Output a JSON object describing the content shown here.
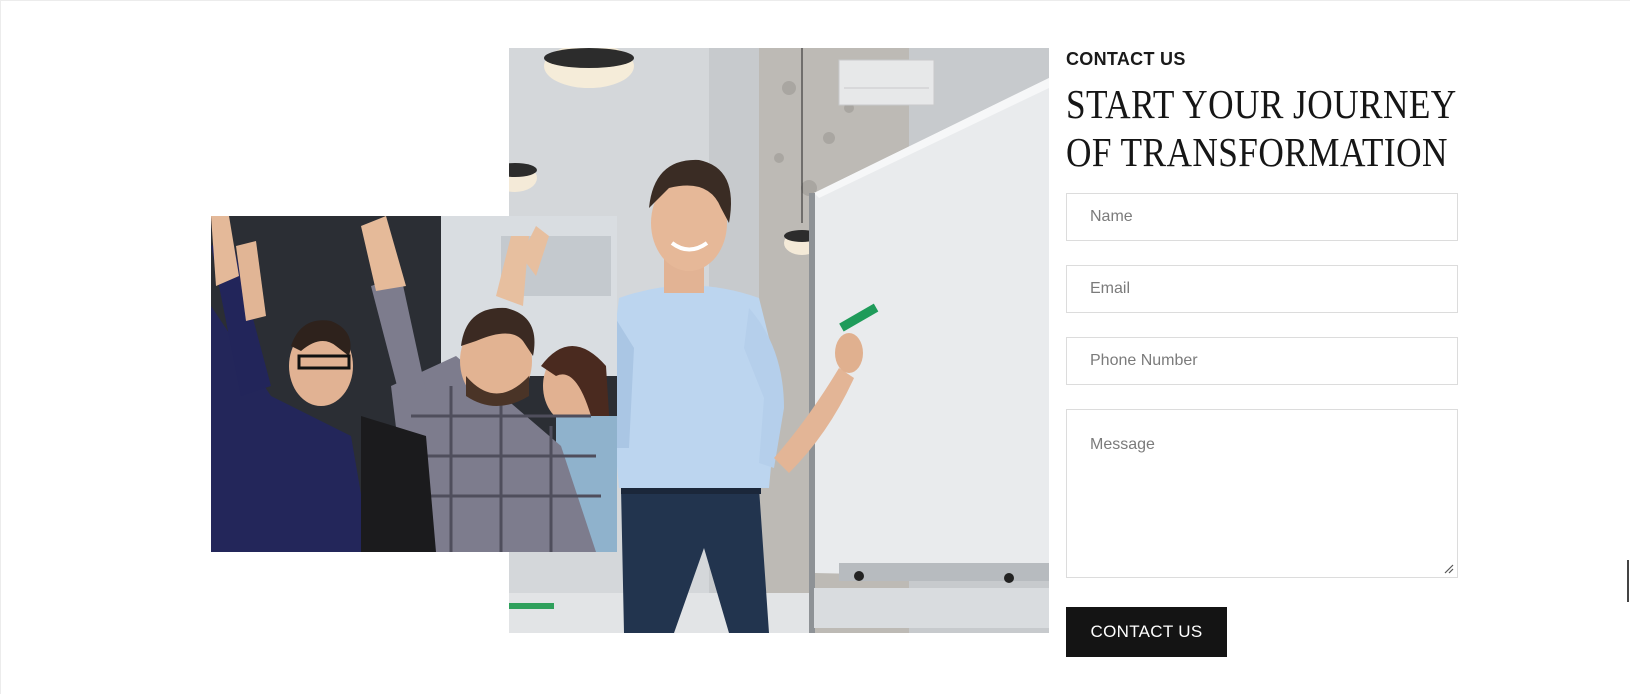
{
  "contact": {
    "eyebrow": "CONTACT US",
    "headline_line1": "START YOUR JOURNEY",
    "headline_line2": "OF TRANSFORMATION"
  },
  "form": {
    "name_placeholder": "Name",
    "email_placeholder": "Email",
    "phone_placeholder": "Phone Number",
    "message_placeholder": "Message",
    "submit_label": "CONTACT US"
  },
  "icons": {
    "resize": "resize-grip-icon"
  },
  "colors": {
    "button_bg": "#141414",
    "button_text": "#ffffff",
    "field_border": "#dcdcdc",
    "placeholder": "#7b7b7b"
  }
}
